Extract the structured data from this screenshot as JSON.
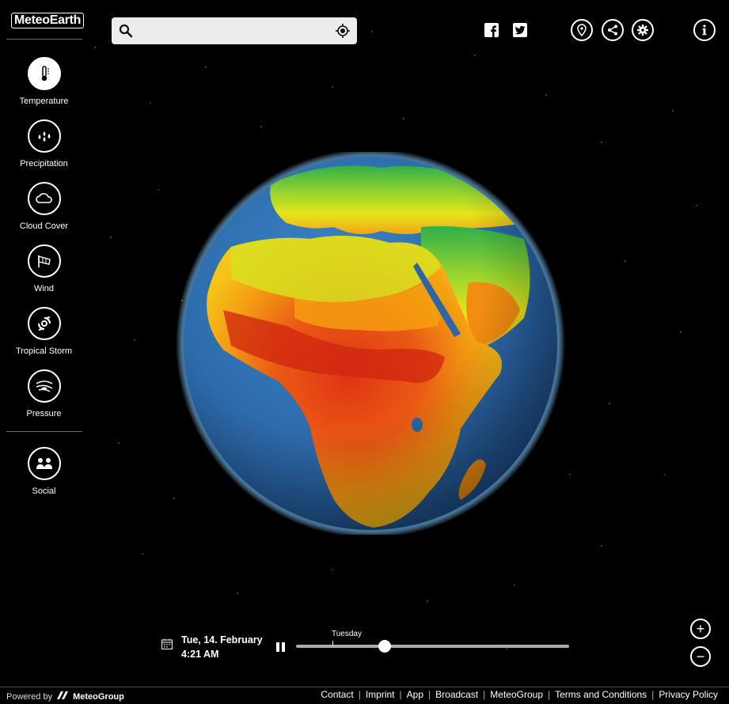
{
  "app": {
    "logo_text": "MeteoEarth"
  },
  "sidebar": {
    "items": [
      {
        "label": "Temperature",
        "icon": "thermometer-icon",
        "active": true
      },
      {
        "label": "Precipitation",
        "icon": "raindrops-icon"
      },
      {
        "label": "Cloud Cover",
        "icon": "cloud-icon"
      },
      {
        "label": "Wind",
        "icon": "windsock-icon"
      },
      {
        "label": "Tropical Storm",
        "icon": "hurricane-icon"
      },
      {
        "label": "Pressure",
        "icon": "isobar-icon"
      }
    ],
    "social": {
      "label": "Social",
      "icon": "people-icon"
    }
  },
  "search": {
    "value": "",
    "placeholder": ""
  },
  "header": {
    "icons": [
      "facebook-icon",
      "twitter-icon",
      "location-pin-icon",
      "share-icon",
      "gear-icon",
      "info-icon"
    ]
  },
  "timeline": {
    "date": "Tue, 14. February",
    "time": "4:21 AM",
    "day_label": "Tuesday",
    "position": 0.325
  },
  "zoom": {
    "in": "+",
    "out": "−"
  },
  "footer": {
    "powered_by": "Powered by",
    "brand": "MeteoGroup",
    "links": [
      "Contact",
      "Imprint",
      "App",
      "Broadcast",
      "MeteoGroup",
      "Terms and Conditions",
      "Privacy Policy"
    ]
  },
  "colors": {
    "background": "#000000",
    "track": "#aaaaaa",
    "ocean": "#2d6fb0",
    "hot": "#d42a10",
    "warm": "#f5a10f",
    "mild": "#d8e020",
    "cool": "#3fb848"
  }
}
